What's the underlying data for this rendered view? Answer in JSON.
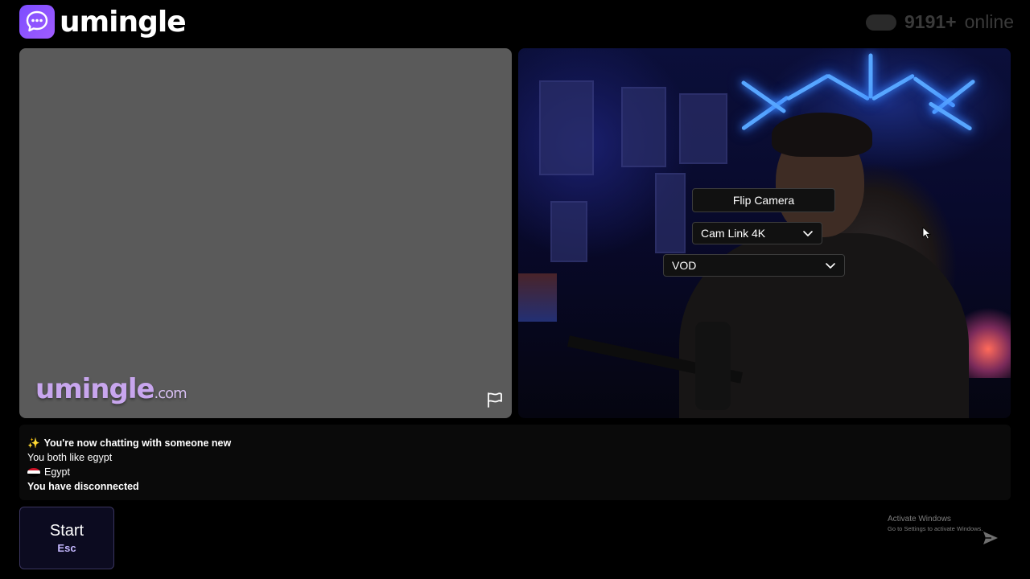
{
  "header": {
    "logo_text": "umingle",
    "online_count": "9191+",
    "online_label": "online"
  },
  "stranger_panel": {
    "watermark_main": "umingle",
    "watermark_suffix": ".com"
  },
  "self_panel": {
    "flip_camera_label": "Flip Camera",
    "camera_select": {
      "selected": "Cam Link 4K"
    },
    "audio_select": {
      "selected": "VOD"
    }
  },
  "chat_log": {
    "lines": [
      {
        "icon": "sparkles-icon",
        "text": "You're now chatting with someone new"
      },
      {
        "text": "You both like egypt"
      },
      {
        "icon": "egypt-flag-icon",
        "text": "Egypt"
      },
      {
        "text": "You have disconnected"
      }
    ],
    "sparkle_glyph": "✨"
  },
  "controls": {
    "start_label": "Start",
    "start_shortcut": "Esc",
    "message_placeholder": ""
  },
  "os_overlay": {
    "activate_title": "Activate Windows",
    "activate_subtitle": "Go to Settings to activate Windows."
  },
  "colors": {
    "brand_purple": "#8b5cf6",
    "start_key": "#c5b8ff",
    "watermark": "#c8a6ee",
    "neon": "#57a6ff"
  }
}
